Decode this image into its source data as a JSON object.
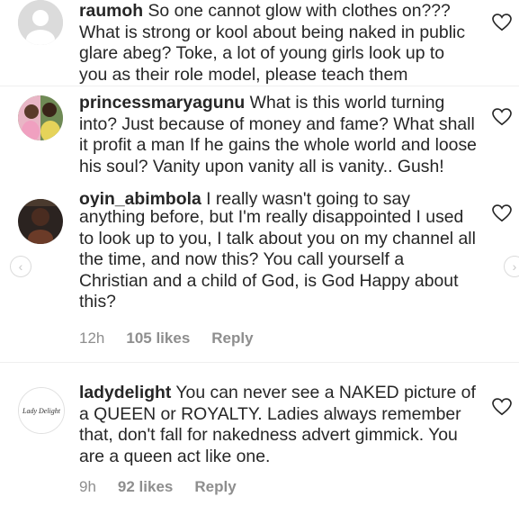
{
  "comments": [
    {
      "username": "raumoh",
      "text": "So one cannot glow with clothes on??? What is strong or kool about being naked in public glare abeg? Toke, a lot of young girls look up to you as their role model, please teach them"
    },
    {
      "username": "princessmaryagunu",
      "text": "What is this world turning into? Just because of money and fame? What shall it profit a man If he gains the whole world and loose his soul? Vanity upon vanity all is vanity.. Gush!"
    },
    {
      "username": "oyin_abimbola",
      "text": "I really wasn't going to say",
      "text_rest": "anything before, but I'm really disappointed I used to look up to you, I talk about you on my channel all the time, and now this? You call yourself a Christian and a child of God, is God Happy about this?",
      "time": "12h",
      "likes": "105 likes",
      "reply": "Reply"
    },
    {
      "username": "ladydelight",
      "avatar_text": "Lady Delight",
      "text": "You can never see a NAKED picture of a QUEEN or ROYALTY. Ladies always remember that, don't fall for nakedness advert gimmick. You are a queen act like one.",
      "time": "9h",
      "likes": "92 likes",
      "reply": "Reply"
    }
  ],
  "icons": {
    "heart": "heart-outline-icon",
    "prev": "chevron-left-icon",
    "next": "chevron-right-icon"
  }
}
